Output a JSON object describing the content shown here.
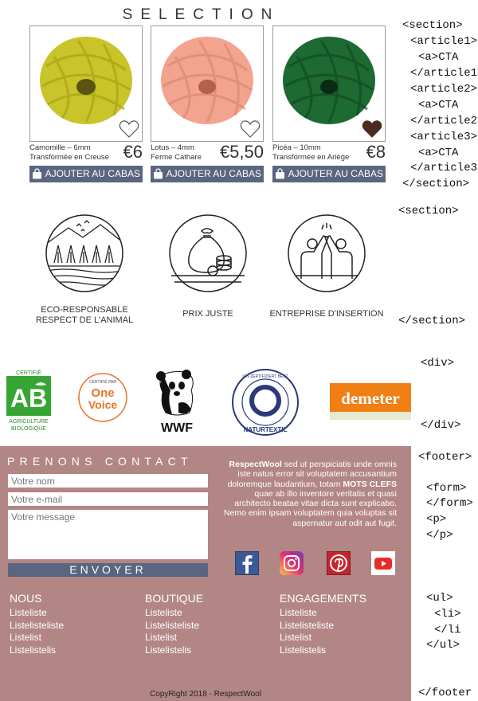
{
  "selection": {
    "title": "SELECTION",
    "products": [
      {
        "name": "Camomille – 6mm",
        "origin": "Transformée en Creuse",
        "price": "€6",
        "cta": "AJOUTER AU CABAS",
        "color": "#c9c42a",
        "heart_filled": false
      },
      {
        "name": "Lotus – 4mm",
        "origin": "Ferme Cathare",
        "price": "€5,50",
        "cta": "AJOUTER AU CABAS",
        "color": "#f0a08c",
        "heart_filled": false
      },
      {
        "name": "Picéa – 10mm",
        "origin": "Transformée en Ariège",
        "price": "€8",
        "cta": "AJOUTER AU CABAS",
        "color": "#1f6b35",
        "heart_filled": true
      }
    ]
  },
  "features": [
    {
      "line1": "ECO-RESPONSABLE",
      "line2": "RESPECT DE L'ANIMAL",
      "icon": "landscape-icon"
    },
    {
      "line1": "PRIX JUSTE",
      "line2": "",
      "icon": "money-bag-icon"
    },
    {
      "line1": "ENTREPRISE D'INSERTION",
      "line2": "",
      "icon": "high-five-icon"
    }
  ],
  "labels": {
    "ab_top": "CERTIFIÉ",
    "ab_mark": "AB",
    "ab_bottom1": "AGRICULTURE",
    "ab_bottom2": "BIOLOGIQUE",
    "onevoice_top": "CERTIFIÉ PAR",
    "onevoice_name1": "One",
    "onevoice_name2": "Voice",
    "wwf": "WWF",
    "naturtextil_ring": "NATURTEXTIL",
    "naturtextil_top": "IVN ZERTIFIZIERT BEST",
    "demeter": "demeter"
  },
  "contact": {
    "title": "PRENONS CONTACT",
    "name_placeholder": "Votre nom",
    "email_placeholder": "Votre e-mail",
    "message_placeholder": "Votre message",
    "send_label": "ENVOYER",
    "about_brand": "RespectWool",
    "about_text_1": " sed ut perspiciatis unde omnis iste natus error sit voluptatem accusantium doloremque laudantium, totam ",
    "about_keywords": "MOTS CLEFS",
    "about_text_2": " quae ab illo inventore veritatis et quasi architecto beatae vitae dicta sunt explicabo. Nemo enim ipsam voluptatem quia voluptas sit aspernatur aut odit aut fugit."
  },
  "social": [
    "facebook-icon",
    "instagram-icon",
    "pinterest-icon",
    "youtube-icon"
  ],
  "footer_columns": [
    {
      "heading": "NOUS",
      "items": [
        "Listeliste",
        "Listelisteliste",
        "Listelist",
        "Listelistelis"
      ]
    },
    {
      "heading": "BOUTIQUE",
      "items": [
        "Listeliste",
        "Listelisteliste",
        "Listelist",
        "Listelistelis"
      ]
    },
    {
      "heading": "ENGAGEMENTS",
      "items": [
        "Listeliste",
        "Listelisteliste",
        "Listelist",
        "Listelistelis"
      ]
    }
  ],
  "copyright": "CopyRight 2018 - RespectWool",
  "annotations": {
    "section_open": "<section>",
    "article1_open": "<article1>",
    "a_cta_1": "<a>CTA",
    "article1_close": "</article1>",
    "article2_open": "<article2>",
    "a_cta_2": "<a>CTA",
    "article2_close": "</article2>",
    "article3_open": "<article3>",
    "a_cta_3": "<a>CTA",
    "article3_close": "</article3>",
    "section_close": "</section>",
    "section2_open": "<section>",
    "section2_close": "</section>",
    "div_open": "<div>",
    "div_close": "</div>",
    "footer_open": "<footer>",
    "form_open": "<form>",
    "form_close": "</form>",
    "p_open": "<p>",
    "p_close": "</p>",
    "ul_open": "<ul>",
    "li_open": "<li>",
    "li_close": "</li",
    "ul_close": "</ul>",
    "footer_close": "</footer"
  }
}
